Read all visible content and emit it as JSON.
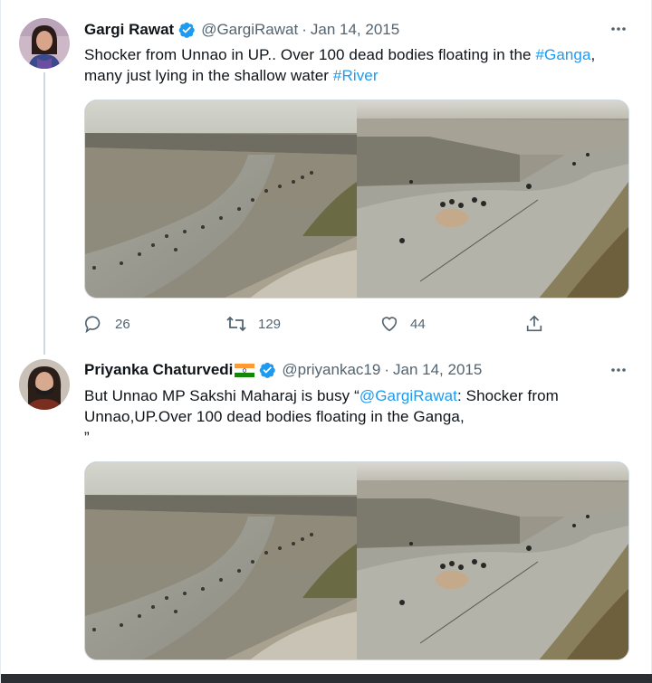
{
  "tweets": [
    {
      "author_name": "Gargi Rawat",
      "handle": "@GargiRawat",
      "separator": "·",
      "date": "Jan 14, 2015",
      "text_line1_plain": "Shocker from Unnao in UP.. Over 100 dead bodies floating in the ",
      "hashtag1": "#Ganga",
      "hashtag1_trail": ",",
      "text_line2_plain": "many just lying in the shallow water ",
      "hashtag2": "#River",
      "replies": "26",
      "retweets": "129",
      "likes": "44",
      "avatar_icon": "woman-avatar-icon",
      "verified_icon": "verified-badge-icon"
    },
    {
      "author_name": "Priyanka Chaturvedi",
      "handle": "@priyankac19",
      "separator": "·",
      "date": "Jan 14, 2015",
      "text_prefix": "But Unnao MP Sakshi Maharaj is busy “",
      "mention": "@GargiRawat",
      "text_after_mention": ": Shocker from",
      "text_line2": "Unnao,UP.Over 100 dead bodies floating in the Ganga,",
      "text_line3": "”",
      "flag_icon": "india-flag-icon",
      "avatar_icon": "woman-masked-avatar-icon",
      "verified_icon": "verified-badge-icon"
    }
  ],
  "colors": {
    "link": "#1d9bf0",
    "verified": "#1d9bf0",
    "secondary_text": "#536471",
    "thread_line": "#cfd9de",
    "bottom_bar": "#2b2f33"
  }
}
